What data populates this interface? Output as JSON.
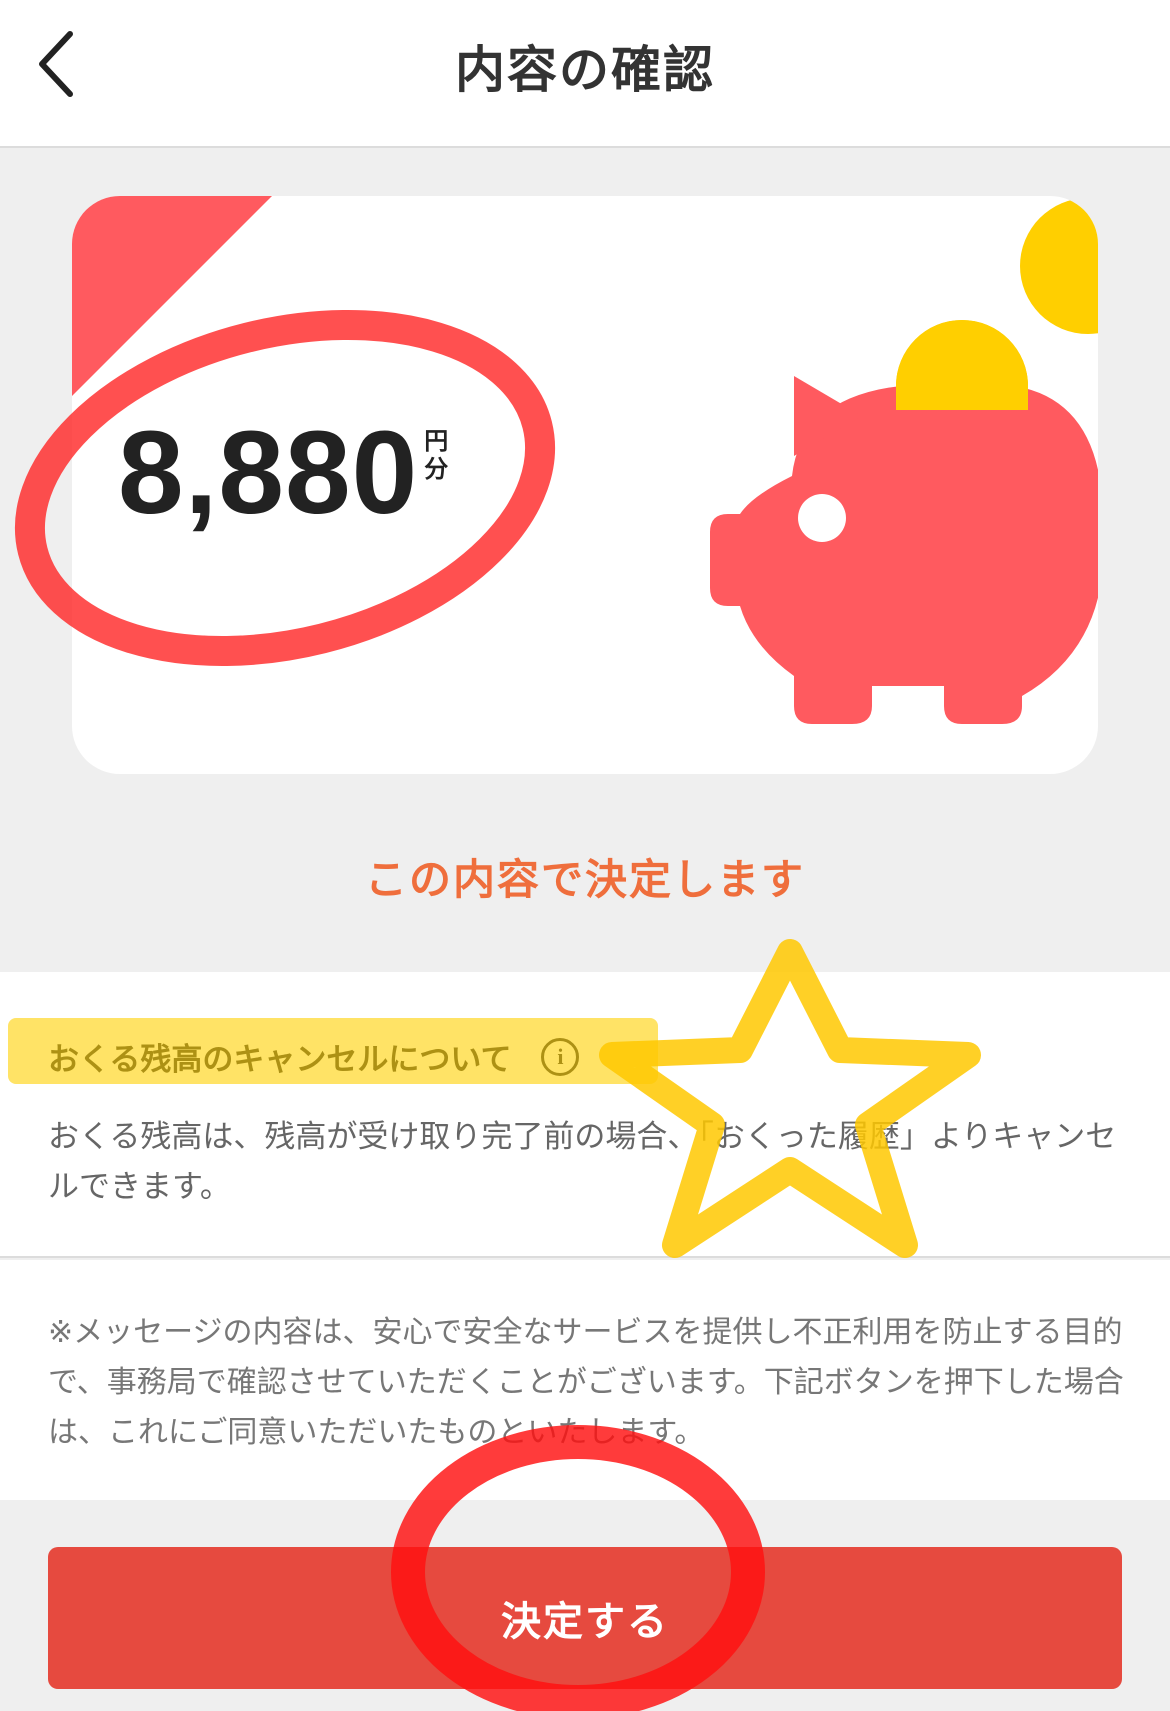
{
  "header": {
    "title": "内容の確認",
    "back_icon": "chevron-left-icon"
  },
  "card": {
    "amount": "8,880",
    "unit_top": "円",
    "unit_bottom": "分",
    "illustration": "piggy-bank-icon",
    "colors": {
      "accent_red": "#ff5a5f",
      "coin_yellow": "#ffcf00"
    }
  },
  "confirm_text": "この内容で決定します",
  "info": {
    "heading": "おくる残高のキャンセルについて",
    "info_icon": "i",
    "body": "おくる残高は、残高が受け取り完了前の場合、「おくった履歴」よりキャンセルできます。"
  },
  "notice": {
    "body": "※メッセージの内容は、安心で安全なサービスを提供し不正利用を防止する目的で、事務局で確認させていただくことがございます。下記ボタンを押下した場合は、これにご同意いただいたものといたします。"
  },
  "submit_button": {
    "label": "決定する",
    "color": "#e64a3f"
  }
}
